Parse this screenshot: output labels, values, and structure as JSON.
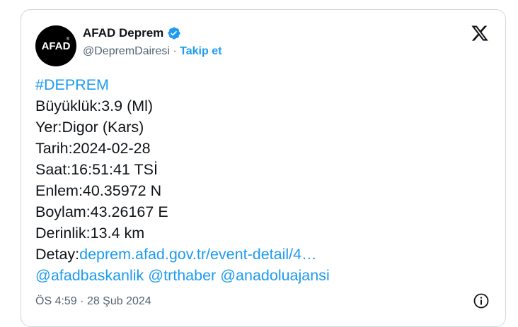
{
  "author": {
    "display_name": "AFAD Deprem",
    "handle": "@DepremDairesi",
    "separator": "·",
    "follow_label": "Takip et",
    "avatar_text": "AFAD",
    "avatar_reg_mark": "®"
  },
  "tweet": {
    "hashtag": "#DEPREM",
    "lines": [
      {
        "label": "Büyüklük:",
        "value": "3.9 (Ml)"
      },
      {
        "label": "Yer:",
        "value": "Digor (Kars)"
      },
      {
        "label": "Tarih:",
        "value": "2024-02-28"
      },
      {
        "label": "Saat:",
        "value": "16:51:41 TSİ"
      },
      {
        "label": "Enlem:",
        "value": "40.35972 N"
      },
      {
        "label": "Boylam:",
        "value": "43.26167 E"
      },
      {
        "label": "Derinlik:",
        "value": "13.4 km"
      }
    ],
    "detail_label": "Detay:",
    "detail_link": "deprem.afad.gov.tr/event-detail/4…",
    "mentions": [
      "@afadbaskanlik",
      "@trthaber",
      "@anadoluajansi"
    ]
  },
  "footer": {
    "time": "ÖS 4:59",
    "separator": "·",
    "date": "28 Şub 2024"
  },
  "colors": {
    "accent": "#1d9bf0",
    "text": "#0f1419",
    "secondary": "#536471",
    "border": "#cfd9de"
  },
  "icons": {
    "verified": "verified-badge-icon",
    "x_logo": "x-logo-icon",
    "info": "info-icon"
  }
}
